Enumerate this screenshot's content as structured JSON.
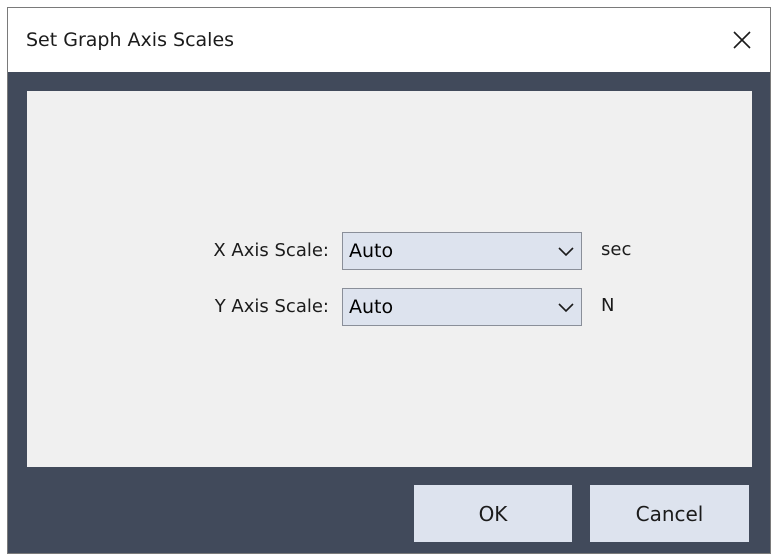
{
  "window": {
    "title": "Set Graph Axis Scales",
    "close_icon": "close-icon"
  },
  "form": {
    "x_axis": {
      "label": "X Axis Scale:",
      "value": "Auto",
      "unit": "sec"
    },
    "y_axis": {
      "label": "Y Axis Scale:",
      "value": "Auto",
      "unit": "N"
    }
  },
  "buttons": {
    "ok": "OK",
    "cancel": "Cancel"
  },
  "colors": {
    "frame": "#414a5b",
    "panel": "#f0f0f0",
    "control": "#dde3ee",
    "titlebar": "#ffffff"
  }
}
